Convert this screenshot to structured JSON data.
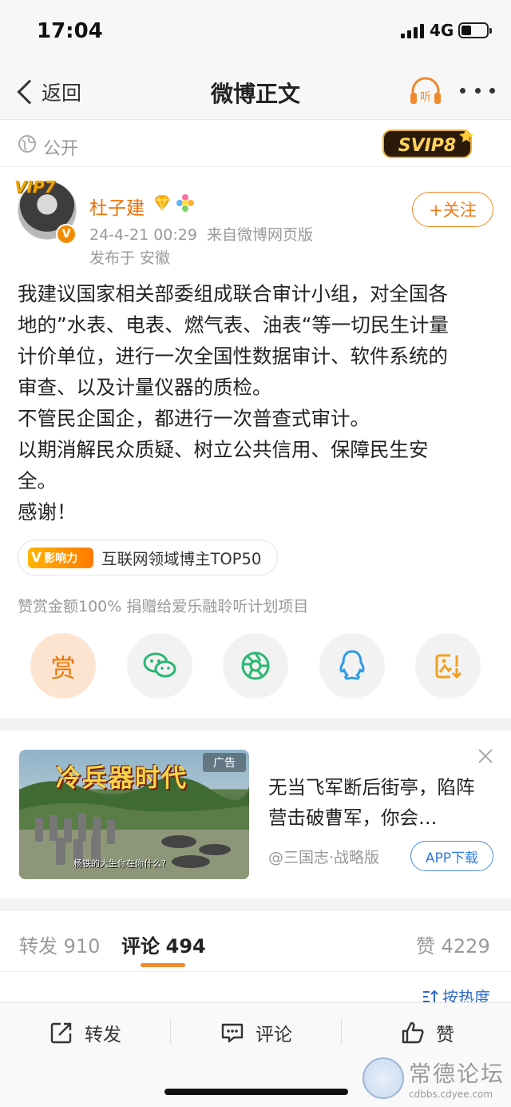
{
  "status_bar": {
    "time": "17:04",
    "network": "4G"
  },
  "nav": {
    "back_label": "返回",
    "title": "微博正文",
    "listen_icon_text": "听"
  },
  "visibility": {
    "label": "公开",
    "svip_badge": "SVIP8"
  },
  "author": {
    "vip_tag": "VIP7",
    "name": "杜子建",
    "timestamp": "24-4-21 00:29",
    "source": "来自微博网页版",
    "location": "发布于 安徽",
    "follow_label": "+关注"
  },
  "post": {
    "lines": [
      "我建议国家相关部委组成联合审计小组，对全国各",
      "地的”水表、电表、燃气表、油表“等一切民生计量",
      "计价单位，进行一次全国性数据审计、软件系统的",
      "审查、以及计量仪器的质检。",
      "不管民企国企，都进行一次普查式审计。",
      "以期消解民众质疑、树立公共信用、保障民生安",
      "全。",
      "感谢！"
    ]
  },
  "influence": {
    "badge": "影响力",
    "text": "互联网领域博主TOP50"
  },
  "donation_note": "赞赏金额100% 捐赠给爱乐融聆听计划项目",
  "share": {
    "reward_label": "赏"
  },
  "ad": {
    "tag": "广告",
    "game_title": "冷兵器时代",
    "caption": "杨铁的大生你在你什么?",
    "headline": "无当飞军断后街亭，陷阵营击破曹军，你会…",
    "source": "@三国志·战略版",
    "cta": "APP下载"
  },
  "tabs": {
    "repost_label": "转发",
    "repost_count": "910",
    "comment_label": "评论",
    "comment_count": "494",
    "like_label": "赞",
    "like_count": "4229"
  },
  "sort_label": "按热度",
  "toolbar": {
    "repost": "转发",
    "comment": "评论",
    "like": "赞"
  },
  "watermark": {
    "title": "常德论坛",
    "url": "cdbbs.cdyee.com"
  },
  "colors": {
    "accent_orange": "#f08a2a",
    "name_orange": "#f06d00",
    "link_blue": "#2f6ac7"
  }
}
